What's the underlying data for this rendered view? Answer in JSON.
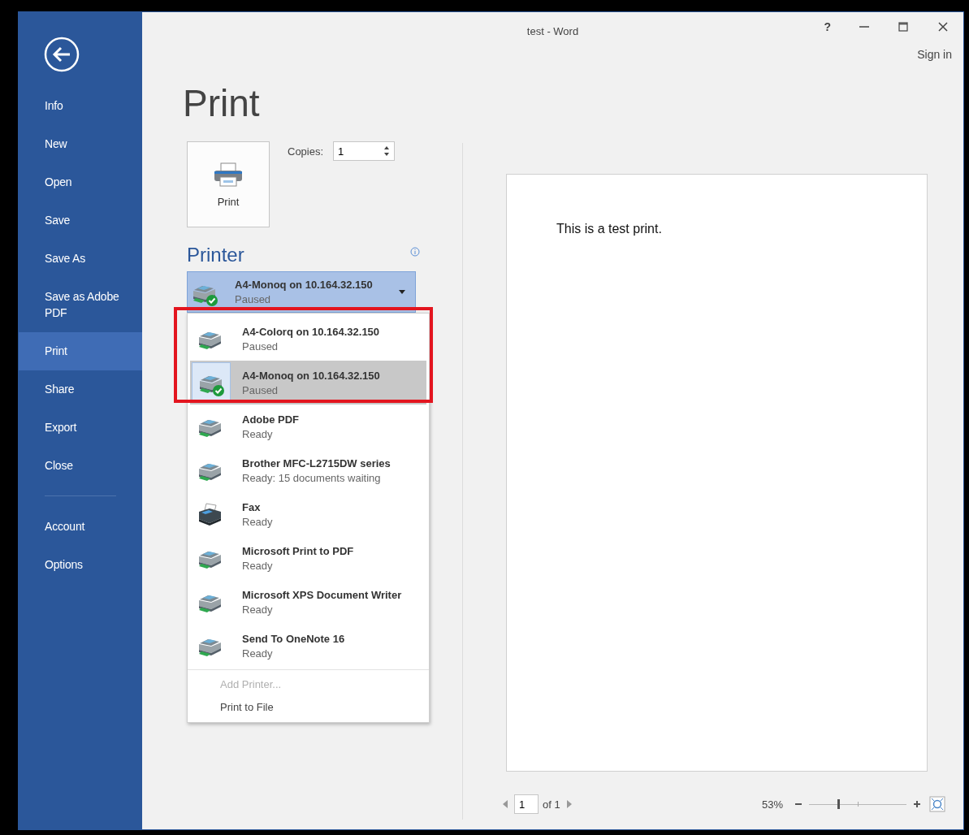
{
  "window": {
    "title": "test - Word",
    "help": "?",
    "sign_in": "Sign in"
  },
  "sidebar": {
    "items": [
      {
        "label": "Info",
        "selected": false
      },
      {
        "label": "New",
        "selected": false
      },
      {
        "label": "Open",
        "selected": false
      },
      {
        "label": "Save",
        "selected": false
      },
      {
        "label": "Save As",
        "selected": false
      },
      {
        "label": "Save as Adobe PDF",
        "selected": false
      },
      {
        "label": "Print",
        "selected": true
      },
      {
        "label": "Share",
        "selected": false
      },
      {
        "label": "Export",
        "selected": false
      },
      {
        "label": "Close",
        "selected": false
      }
    ],
    "footer_items": [
      {
        "label": "Account",
        "selected": false
      },
      {
        "label": "Options",
        "selected": false
      }
    ]
  },
  "print_panel": {
    "heading": "Print",
    "print_button": "Print",
    "copies_label": "Copies:",
    "copies_value": "1",
    "printer_heading": "Printer",
    "printer_combo": {
      "name": "A4-Monoq on 10.164.32.150",
      "status": "Paused",
      "kind": "printer",
      "default": true
    },
    "printer_list": [
      {
        "name": "A4-Colorq on 10.164.32.150",
        "status": "Paused",
        "kind": "printer",
        "default": false,
        "selected": false
      },
      {
        "name": "A4-Monoq on 10.164.32.150",
        "status": "Paused",
        "kind": "printer",
        "default": true,
        "selected": true
      },
      {
        "name": "Adobe PDF",
        "status": "Ready",
        "kind": "printer",
        "default": false,
        "selected": false
      },
      {
        "name": "Brother MFC-L2715DW series",
        "status": "Ready: 15 documents waiting",
        "kind": "printer",
        "default": false,
        "selected": false
      },
      {
        "name": "Fax",
        "status": "Ready",
        "kind": "fax",
        "default": false,
        "selected": false
      },
      {
        "name": "Microsoft Print to PDF",
        "status": "Ready",
        "kind": "printer",
        "default": false,
        "selected": false
      },
      {
        "name": "Microsoft XPS Document Writer",
        "status": "Ready",
        "kind": "printer",
        "default": false,
        "selected": false
      },
      {
        "name": "Send To OneNote 16",
        "status": "Ready",
        "kind": "printer",
        "default": false,
        "selected": false
      }
    ],
    "list_actions": [
      {
        "label": "Add Printer...",
        "disabled": true
      },
      {
        "label": "Print to File",
        "disabled": false
      }
    ],
    "annotation": {
      "kind": "highlight-box",
      "color": "#e3151f"
    }
  },
  "preview": {
    "text": "This is a test print.",
    "page_value": "1",
    "page_of": "of 1",
    "zoom": "53%",
    "zoom_level": {
      "level": 0.3
    }
  }
}
